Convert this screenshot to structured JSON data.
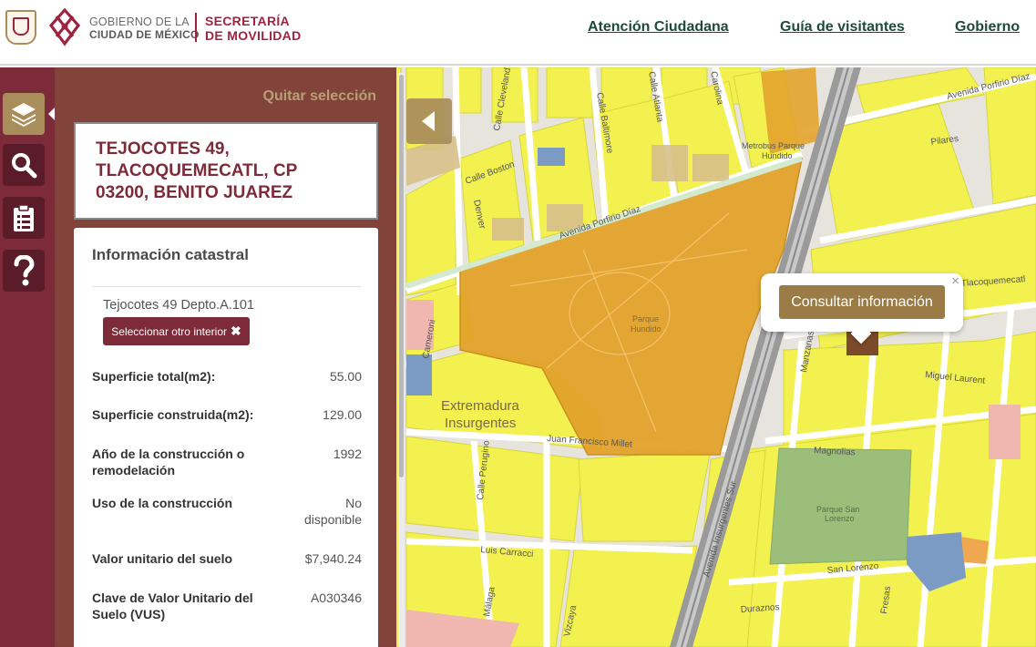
{
  "header": {
    "gobierno_line1": "GOBIERNO DE LA",
    "gobierno_line2": "CIUDAD DE MÉXICO",
    "secretaria_line1": "SECRETARÍA",
    "secretaria_line2": "DE MOVILIDAD",
    "nav": [
      "Atención Ciudadana",
      "Guía de visitantes",
      "Gobierno"
    ]
  },
  "colors": {
    "brand": "#9f2241",
    "gold": "#a98d5b",
    "panel": "#702638",
    "map_lot": "#f2f150",
    "map_park": "#e3a32c"
  },
  "sidebar_icons": [
    "layers-icon",
    "search-icon",
    "clipboard-icon",
    "help-icon"
  ],
  "panel": {
    "quitar": "Quitar selección",
    "address_lines": [
      "TEJOCOTES 49,",
      "TLACOQUEMECATL, CP",
      "03200, BENITO JUAREZ"
    ],
    "section_title": "Información catastral",
    "interior": "Tejocotes 49 Depto.A.101",
    "select_other": "Seleccionar otro interior",
    "rows": [
      {
        "k": "Superficie total(m2):",
        "v": "55.00"
      },
      {
        "k": "Superficie construida(m2):",
        "v": "129.00"
      },
      {
        "k": "Año de la construcción o remodelación",
        "v": "1992"
      },
      {
        "k": "Uso de la construcción",
        "v": "No disponible"
      },
      {
        "k": "Valor unitario del suelo",
        "v": "$7,940.24"
      },
      {
        "k": "Clave de Valor Unitario del Suelo (VUS)",
        "v": "A030346"
      }
    ]
  },
  "map": {
    "popup_button": "Consultar información",
    "popup_close": "×",
    "labels": {
      "extremadura_1": "Extremadura",
      "extremadura_2": "Insurgentes",
      "parque_hundido_1": "Parque",
      "parque_hundido_2": "Hundido",
      "parque_san_lorenzo_1": "Parque San",
      "parque_san_lorenzo_2": "Lorenzo",
      "metrobus_1": "Metrobus Parque",
      "metrobus_2": "Hundido",
      "av_porfirio_diaz": "Avenida Porfirio Díaz",
      "av_porfirio_diaz_ne": "Avenida Porfirio Díaz",
      "av_insurgentes": "Avenida Insurgentes Sur",
      "calle_boston": "Calle Boston",
      "calle_cleveland": "Calle Cleveland",
      "calle_baltimore": "Calle Baltimore",
      "calle_atlanta": "Calle Atlanta",
      "carolina": "Carolina",
      "denver": "Denver",
      "pilares": "Pilares",
      "tlacoquemecatl": "Tlacoquemecatl",
      "manzanas": "Manzanas",
      "miguel_laurent": "Miguel Laurent",
      "juan_francisco_millet": "Juan Francisco Millet",
      "magnolias": "Magnolias",
      "luis_carracci": "Luis Carracci",
      "san_lorenzo": "San Lorenzo",
      "duraznos": "Duraznos",
      "fresas": "Fresas",
      "malaga": "Málaga",
      "vizcaya": "Vizcaya",
      "perugino": "Calle Perugino",
      "cameroni": "Cameroni"
    }
  }
}
